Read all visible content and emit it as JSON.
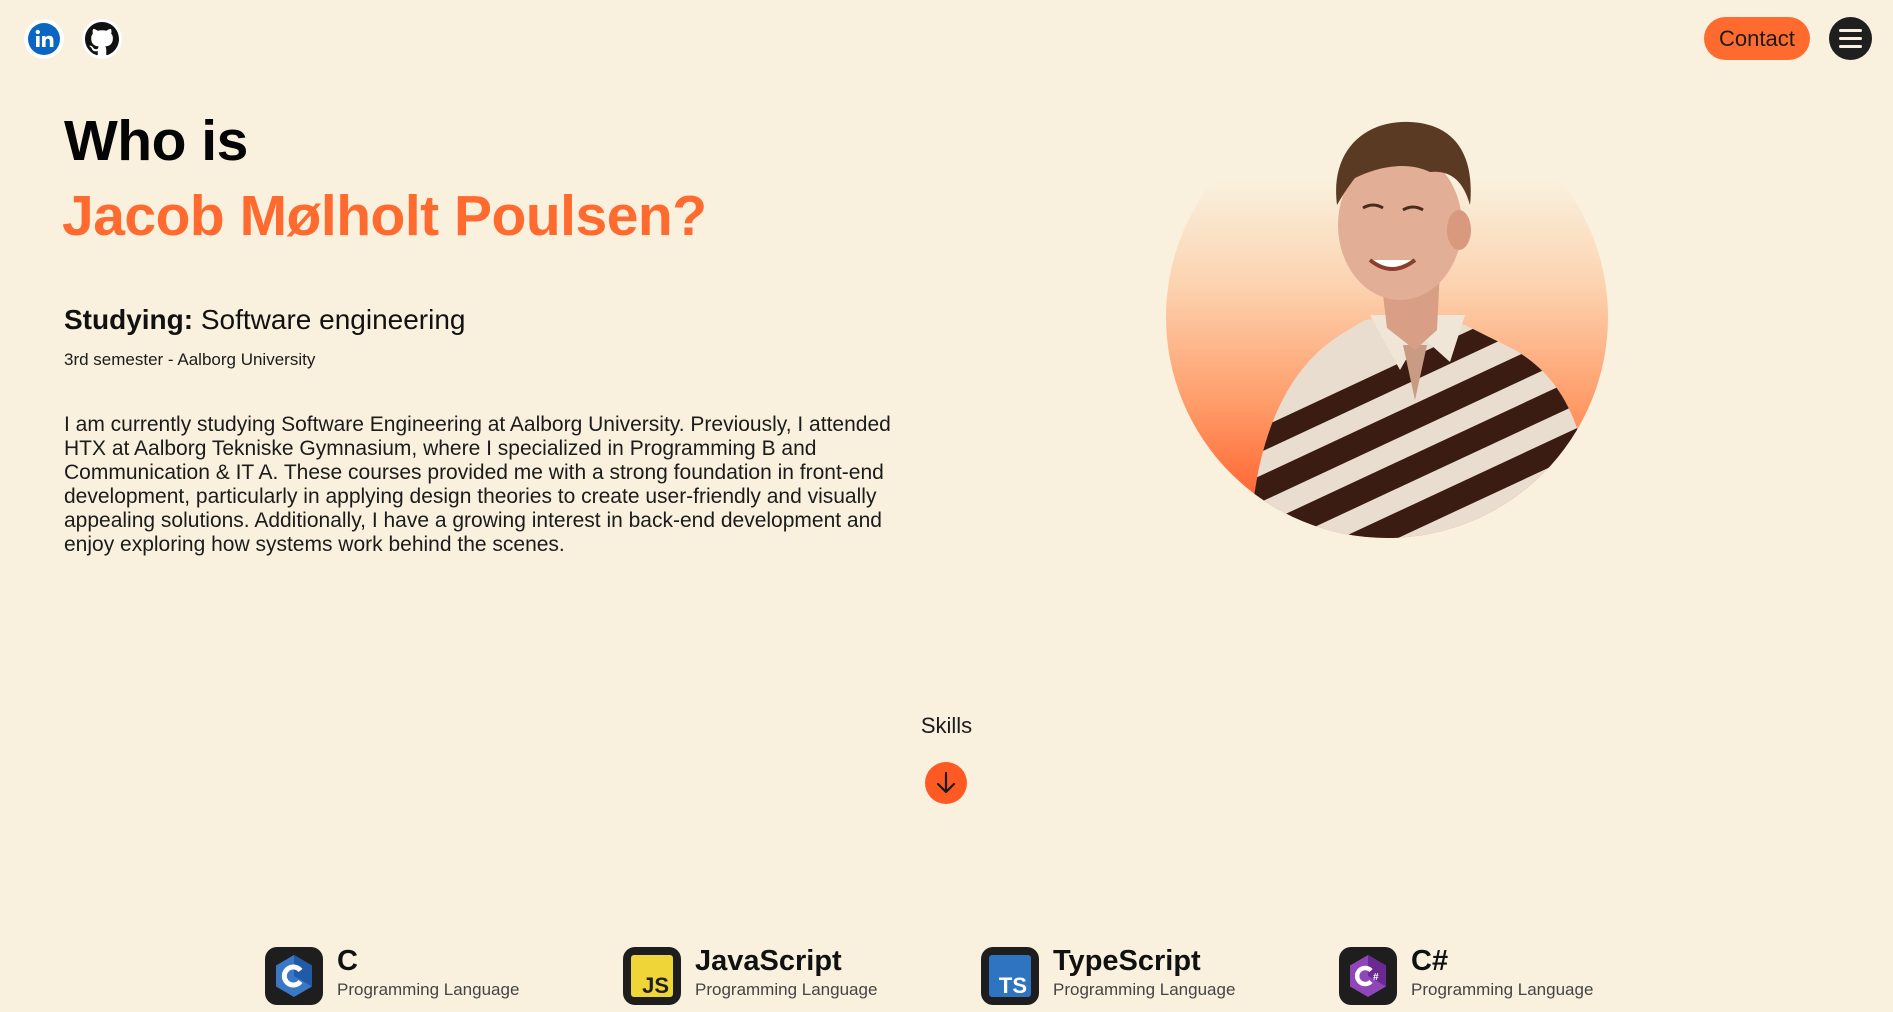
{
  "header": {
    "social": [
      {
        "icon": "linkedin-icon"
      },
      {
        "icon": "github-icon"
      }
    ],
    "contact_label": "Contact",
    "menu_icon": "hamburger-menu-icon"
  },
  "hero": {
    "heading_line1": "Who is",
    "heading_line2": "Jacob Mølholt Poulsen?",
    "studying_label": "Studying:",
    "studying_value": "Software engineering",
    "semester": "3rd semester - Aalborg University",
    "bio": "I am currently studying Software Engineering at Aalborg University. Previously, I attended HTX at Aalborg Tekniske Gymnasium, where I specialized in Programming B and Communication & IT A. These courses provided me with a strong foundation in front-end development, particularly in applying design theories to create user-friendly and visually appealing solutions. Additionally, I have a growing interest in back-end development and enjoy exploring how systems work behind the scenes."
  },
  "skills": {
    "label": "Skills",
    "scroll_icon": "arrow-down-icon",
    "items": [
      {
        "name": "C",
        "type": "Programming Language",
        "icon": "c-language-icon"
      },
      {
        "name": "JavaScript",
        "type": "Programming Language",
        "icon": "javascript-icon"
      },
      {
        "name": "TypeScript",
        "type": "Programming Language",
        "icon": "typescript-icon"
      },
      {
        "name": "C#",
        "type": "Programming Language",
        "icon": "csharp-icon"
      }
    ]
  },
  "colors": {
    "background": "#f9f1de",
    "accent": "#ff6a2e",
    "dark": "#1f1f1f"
  }
}
